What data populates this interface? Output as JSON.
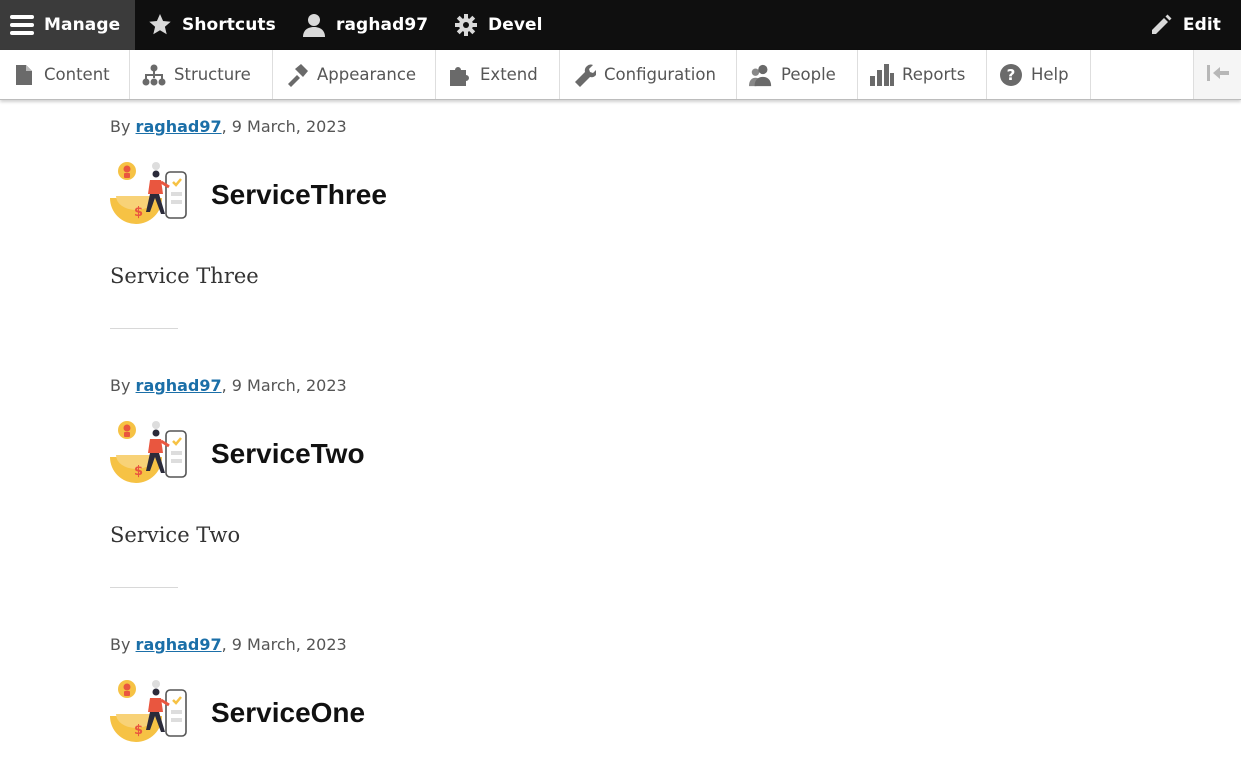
{
  "toolbar": {
    "manage": "Manage",
    "shortcuts": "Shortcuts",
    "user": "raghad97",
    "devel": "Devel",
    "edit": "Edit"
  },
  "tray": {
    "items": [
      {
        "label": "Content",
        "icon": "file-icon"
      },
      {
        "label": "Structure",
        "icon": "sitemap-icon"
      },
      {
        "label": "Appearance",
        "icon": "paintbrush-icon"
      },
      {
        "label": "Extend",
        "icon": "puzzle-icon"
      },
      {
        "label": "Configuration",
        "icon": "wrench-icon"
      },
      {
        "label": "People",
        "icon": "people-icon"
      },
      {
        "label": "Reports",
        "icon": "bar-chart-icon"
      },
      {
        "label": "Help",
        "icon": "help-icon"
      }
    ]
  },
  "nodes": [
    {
      "by": "By",
      "author": "raghad97",
      "date": ", 9 March, 2023",
      "title": "ServiceThree",
      "body": "Service Three"
    },
    {
      "by": "By",
      "author": "raghad97",
      "date": ", 9 March, 2023",
      "title": "ServiceTwo",
      "body": "Service Two"
    },
    {
      "by": "By",
      "author": "raghad97",
      "date": ", 9 March, 2023",
      "title": "ServiceOne",
      "body": ""
    }
  ],
  "colors": {
    "toolbar_bg": "#0f0f0f",
    "manage_bg": "#3b3b3b",
    "link": "#1b6fa8",
    "illustration_yellow": "#f6c244",
    "illustration_red": "#e9563f"
  }
}
